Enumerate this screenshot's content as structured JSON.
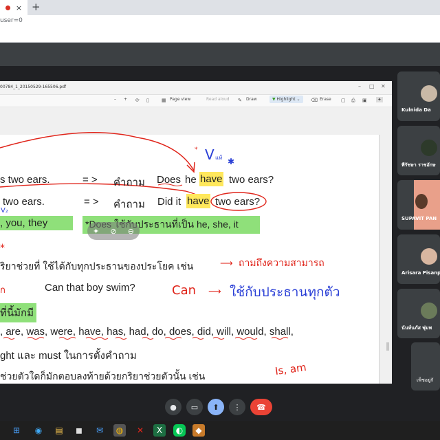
{
  "browser": {
    "new_tab_label": "+",
    "tab_close": "×",
    "url_fragment": "user=0"
  },
  "pdf": {
    "title": "00784_1_20150529-165506.pdf",
    "window_controls": [
      "–",
      "□",
      "✕"
    ],
    "toolbar": {
      "zoom_out": "–",
      "zoom_in": "+",
      "page_view": "Page view",
      "read_aloud": "Read aloud",
      "draw": "Draw",
      "highlight": "Highlight",
      "erase": "Erase"
    }
  },
  "page_text": {
    "line1_left": "s two ears.",
    "line1_arrow": "= >",
    "line1_thai": "คำถาม",
    "line1_q_does": "Does",
    "line1_q_he": "he",
    "line1_q_have": "have",
    "line1_q_rest": "two ears?",
    "line2_left": "two ears.",
    "line2_arrow": "= >",
    "line2_thai": "คำถาม",
    "line2_q_did": "Did it",
    "line2_q_have": "have",
    "line2_q_rest": "two ears?",
    "line3_left": ", you, they",
    "line3_right": "*Does ใช้กับประธานที่เป็น  he, she, it",
    "line4": "ริยาช่วยที่ ใช้ได้กับทุกประธานของประโยค เช่น",
    "line5_example": "Can that boy swim?",
    "line6": "ที่นี้มักมี",
    "line7": ", are, was, were, have, has, had, do, does, did, will, would, shall,",
    "line8": "ght และ  must ในการตั้งคำถาม",
    "line9": "ช่วยตัวใดก็มักตอบลงท้ายด้วยกริยาช่วยตัวนั้น เช่น"
  },
  "annotations": {
    "v_mark": "V",
    "v_sub": "แท้",
    "v2_mark": "V₂",
    "red_stars": "*",
    "red_note_1": "ถามถึงความสามารถ",
    "can_note": "Can",
    "blue_note": "ใช้กับประธานทุกตัว",
    "is_am_note": "Is, am",
    "left_note": "ก"
  },
  "participants": [
    {
      "name": "Kulnida Da"
    },
    {
      "name": "พีรัชษา ราชอักษ"
    },
    {
      "name": "SUPAVIT PAN"
    },
    {
      "name": "Arisara Pisanp"
    },
    {
      "name": "นันท์นภัส พุ่มพ"
    },
    {
      "name": "เพ็ชอยู่กั"
    }
  ],
  "controls": {
    "mic_icon": "🎤",
    "camera_icon": "▭",
    "present_icon": "⬆",
    "more_icon": "⋮",
    "hangup_icon": "☎"
  },
  "taskbar": [
    "⊞",
    "◉",
    "▤",
    "◼",
    "✉",
    "◍",
    "✕",
    "X",
    "◐",
    "◆"
  ],
  "colors": {
    "highlight_green": "#8fe07a",
    "highlight_yellow": "#ffe85c",
    "ink_red": "#e0251b",
    "ink_blue": "#2a3fd6",
    "hangup": "#ea4335",
    "present": "#8ab4f8"
  }
}
